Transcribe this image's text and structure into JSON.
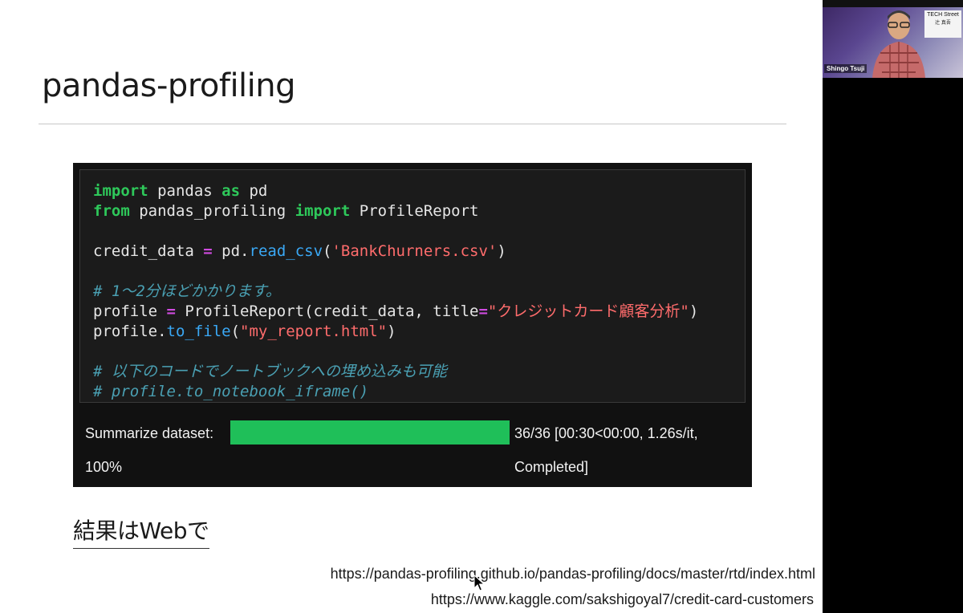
{
  "slide": {
    "title": "pandas-profiling",
    "result_heading": "結果はWebで",
    "links": [
      "https://pandas-profiling.github.io/pandas-profiling/docs/master/rtd/index.html",
      "https://www.kaggle.com/sakshigoyal7/credit-card-customers"
    ]
  },
  "code": {
    "line1": {
      "kw1": "import",
      "mod": " pandas ",
      "kw2": "as",
      "alias": " pd"
    },
    "line2": {
      "kw1": "from",
      "mod": " pandas_profiling ",
      "kw2": "import",
      "name": " ProfileReport"
    },
    "line3": {
      "var": "credit_data ",
      "op": "=",
      "obj": " pd.",
      "fn": "read_csv",
      "open": "(",
      "str": "'BankChurners.csv'",
      "close": ")"
    },
    "line4": {
      "comment": "# 1〜2分ほどかかります。"
    },
    "line5": {
      "var": "profile ",
      "op": "=",
      "call": " ProfileReport(credit_data, title",
      "op2": "=",
      "str": "\"クレジットカード顧客分析\"",
      "close": ")"
    },
    "line6": {
      "obj": "profile.",
      "fn": "to_file",
      "open": "(",
      "str": "\"my_report.html\"",
      "close": ")"
    },
    "line7": {
      "comment": "# 以下のコードでノートブックへの埋め込みも可能"
    },
    "line8": {
      "comment": "# profile.to_notebook_iframe()"
    }
  },
  "progress": {
    "label": "Summarize dataset:",
    "percent_text": "100%",
    "fraction": 1.0,
    "stats": "36/36 [00:30<00:00, 1.26s/it,",
    "status": "Completed]",
    "bar_color": "#1fbf59"
  },
  "webcam": {
    "speaker_name": "Shingo Tsuji",
    "sign_title": "TECH Street",
    "sign_subtitle": "辻 真吾"
  },
  "colors": {
    "keyword": "#2ec85a",
    "operator": "#d04be0",
    "function": "#3aa8f5",
    "string": "#ff6c6c",
    "comment": "#4aa0b3"
  }
}
